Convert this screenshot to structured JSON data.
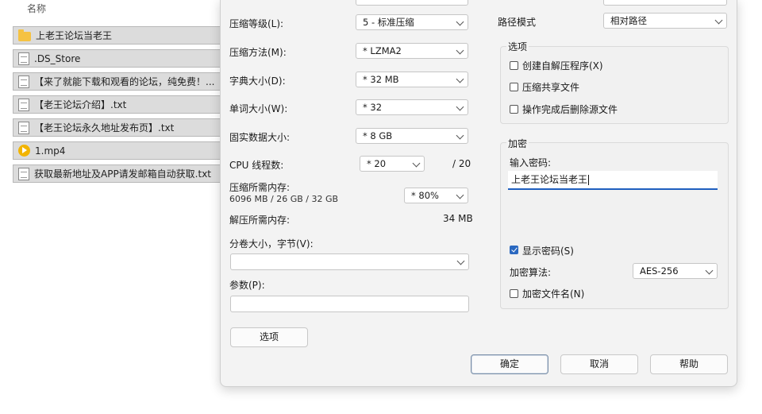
{
  "file_list": {
    "column_header": "名称",
    "items": [
      {
        "name": "上老王论坛当老王",
        "icon": "folder-icon"
      },
      {
        "name": ".DS_Store",
        "icon": "document-icon"
      },
      {
        "name": "【来了就能下载和观看的论坛，纯免费！...",
        "icon": "document-icon"
      },
      {
        "name": "【老王论坛介绍】.txt",
        "icon": "document-icon"
      },
      {
        "name": "【老王论坛永久地址发布页】.txt",
        "icon": "document-icon"
      },
      {
        "name": "1.mp4",
        "icon": "video-icon"
      },
      {
        "name": "获取最新地址及APP请发邮箱自动获取.txt",
        "icon": "document-icon"
      }
    ]
  },
  "dialog": {
    "compression_level": {
      "label": "压缩等级(L):",
      "value": "5 - 标准压缩"
    },
    "compression_method": {
      "label": "压缩方法(M):",
      "value": "* LZMA2"
    },
    "dictionary_size": {
      "label": "字典大小(D):",
      "value": "* 32 MB"
    },
    "word_size": {
      "label": "单词大小(W):",
      "value": "* 32"
    },
    "solid_block_size": {
      "label": "固实数据大小:",
      "value": "* 8 GB"
    },
    "cpu_threads": {
      "label": "CPU 线程数:",
      "value": "* 20",
      "max": "/ 20"
    },
    "compress_memory": {
      "label": "压缩所需内存:",
      "detail": "6096 MB / 26 GB / 32 GB",
      "value": "* 80%"
    },
    "decompress_memory": {
      "label": "解压所需内存:",
      "value": "34 MB"
    },
    "split_volume": {
      "label": "分卷大小，字节(V):",
      "value": ""
    },
    "parameters": {
      "label": "参数(P):",
      "value": ""
    },
    "options_button": "选项",
    "path_mode": {
      "label": "路径模式",
      "value": "相对路径"
    },
    "options_group": {
      "title": "选项",
      "items": [
        {
          "label": "创建自解压程序(X)",
          "checked": false
        },
        {
          "label": "压缩共享文件",
          "checked": false
        },
        {
          "label": "操作完成后删除源文件",
          "checked": false
        }
      ]
    },
    "encryption_group": {
      "title": "加密",
      "password_label": "输入密码:",
      "password_value": "上老王论坛当老王",
      "show_password": {
        "label": "显示密码(S)",
        "checked": true
      },
      "method_label": "加密算法:",
      "method_value": "AES-256",
      "encrypt_names": {
        "label": "加密文件名(N)",
        "checked": false
      }
    },
    "buttons": {
      "ok": "确定",
      "cancel": "取消",
      "help": "帮助"
    }
  },
  "colors": {
    "accent": "#1f5fbf",
    "checkbox_on": "#2a68c0",
    "folder": "#f5c242",
    "video": "#f2b400"
  }
}
